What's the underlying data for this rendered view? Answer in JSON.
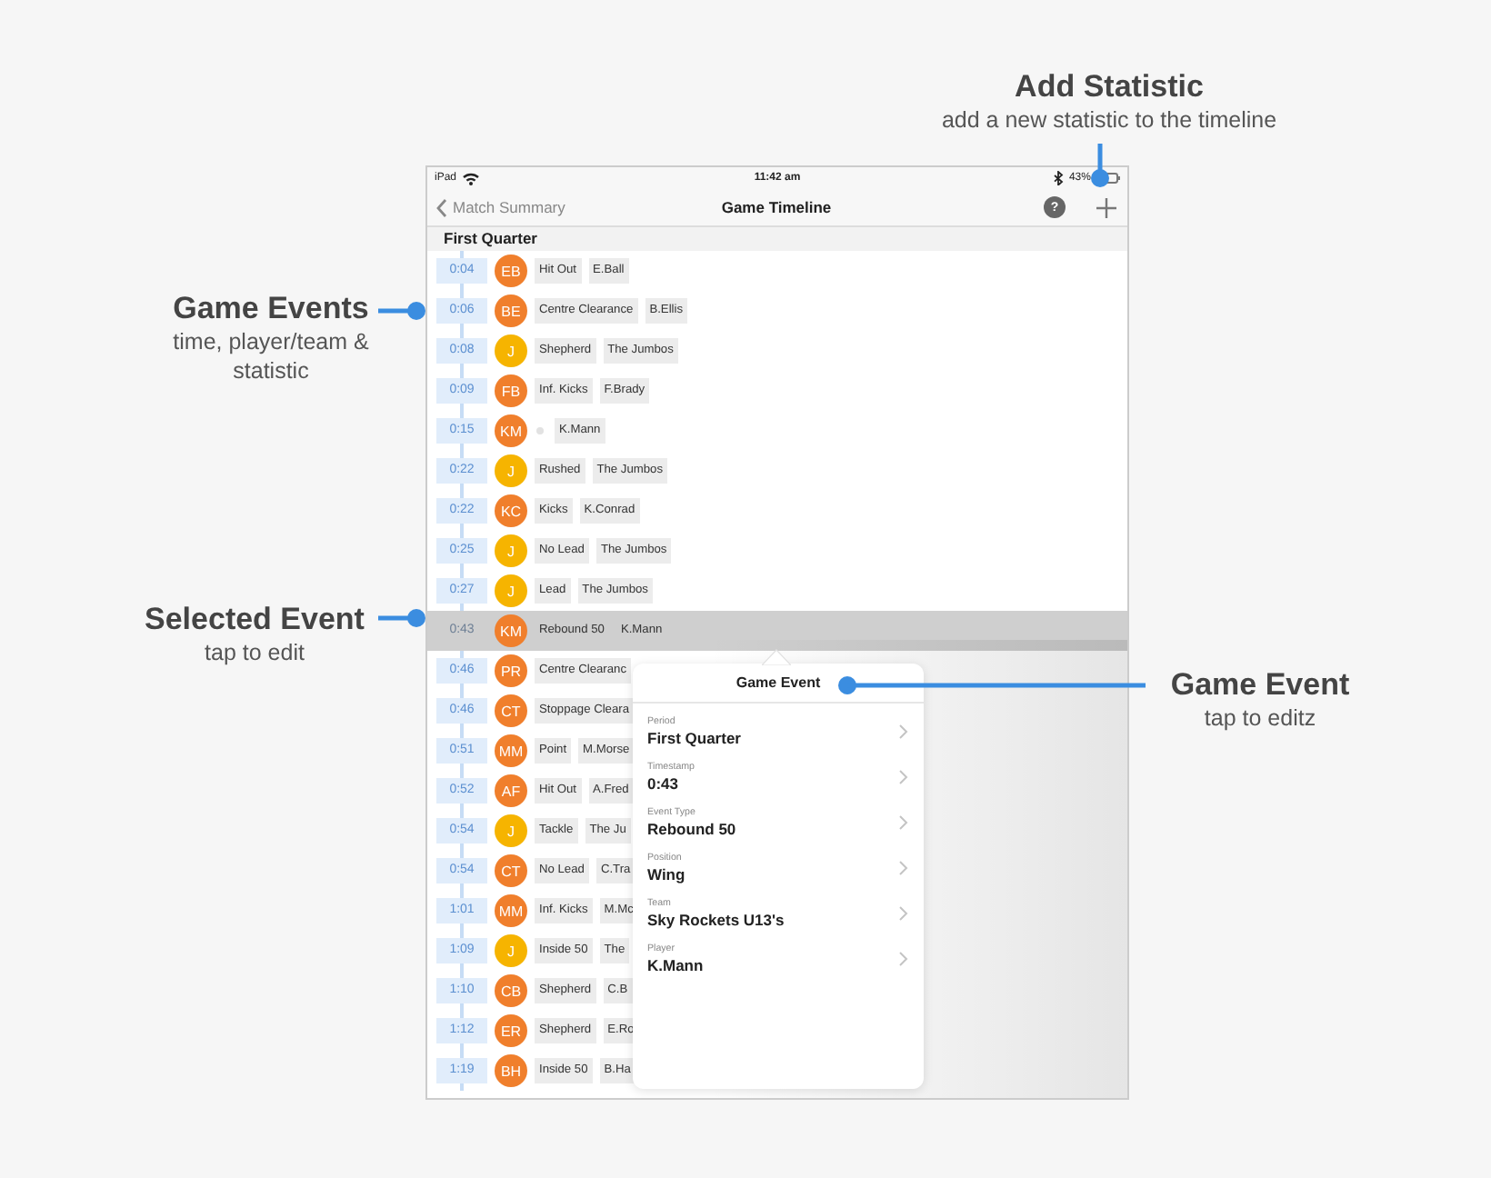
{
  "annotations": [
    {
      "title": "Add Statistic",
      "subtitle": "add a new statistic to the timeline"
    },
    {
      "title": "Game Events",
      "subtitle": "time, player/team & statistic"
    },
    {
      "title": "Selected Event",
      "subtitle": "tap to edit"
    },
    {
      "title": "Game Event",
      "subtitle": "tap to editz"
    }
  ],
  "status_bar": {
    "carrier": "iPad",
    "time": "11:42 am",
    "battery": "43%"
  },
  "nav": {
    "back": "Match Summary",
    "title": "Game Timeline",
    "help": "?"
  },
  "section": "First Quarter",
  "events": [
    {
      "time": "0:04",
      "initials": "EB",
      "color": "#f07f2c",
      "event": "Hit Out",
      "player": "E.Ball",
      "selected": false
    },
    {
      "time": "0:06",
      "initials": "BE",
      "color": "#f07f2c",
      "event": "Centre Clearance",
      "player": "B.Ellis",
      "selected": false
    },
    {
      "time": "0:08",
      "initials": "J",
      "color": "#f6b400",
      "event": "Shepherd",
      "player": "The Jumbos",
      "selected": false
    },
    {
      "time": "0:09",
      "initials": "FB",
      "color": "#f07f2c",
      "event": "Inf. Kicks",
      "player": "F.Brady",
      "selected": false
    },
    {
      "time": "0:15",
      "initials": "KM",
      "color": "#f07f2c",
      "player": "K.Mann",
      "selected": false
    },
    {
      "time": "0:22",
      "initials": "J",
      "color": "#f6b400",
      "event": "Rushed",
      "player": "The Jumbos",
      "selected": false
    },
    {
      "time": "0:22",
      "initials": "KC",
      "color": "#f07f2c",
      "event": "Kicks",
      "player": "K.Conrad",
      "selected": false
    },
    {
      "time": "0:25",
      "initials": "J",
      "color": "#f6b400",
      "event": "No Lead",
      "player": "The Jumbos",
      "selected": false
    },
    {
      "time": "0:27",
      "initials": "J",
      "color": "#f6b400",
      "event": "Lead",
      "player": "The Jumbos",
      "selected": false
    },
    {
      "time": "0:43",
      "initials": "KM",
      "color": "#f07f2c",
      "event": "Rebound 50",
      "player": "K.Mann",
      "selected": true
    },
    {
      "time": "0:46",
      "initials": "PR",
      "color": "#f07f2c",
      "event": "Centre Clearanc",
      "selected": false
    },
    {
      "time": "0:46",
      "initials": "CT",
      "color": "#f07f2c",
      "event": "Stoppage Cleara",
      "selected": false
    },
    {
      "time": "0:51",
      "initials": "MM",
      "color": "#f07f2c",
      "event": "Point",
      "player": "M.Morse",
      "selected": false
    },
    {
      "time": "0:52",
      "initials": "AF",
      "color": "#f07f2c",
      "event": "Hit Out",
      "player": "A.Fred",
      "selected": false
    },
    {
      "time": "0:54",
      "initials": "J",
      "color": "#f6b400",
      "event": "Tackle",
      "player": "The Ju",
      "selected": false
    },
    {
      "time": "0:54",
      "initials": "CT",
      "color": "#f07f2c",
      "event": "No Lead",
      "player": "C.Tra",
      "selected": false
    },
    {
      "time": "1:01",
      "initials": "MM",
      "color": "#f07f2c",
      "event": "Inf. Kicks",
      "player": "M.Mc",
      "selected": false
    },
    {
      "time": "1:09",
      "initials": "J",
      "color": "#f6b400",
      "event": "Inside 50",
      "player": "The",
      "selected": false
    },
    {
      "time": "1:10",
      "initials": "CB",
      "color": "#f07f2c",
      "event": "Shepherd",
      "player": "C.B",
      "selected": false
    },
    {
      "time": "1:12",
      "initials": "ER",
      "color": "#f07f2c",
      "event": "Shepherd",
      "player": "E.Ro",
      "selected": false
    },
    {
      "time": "1:19",
      "initials": "BH",
      "color": "#f07f2c",
      "event": "Inside 50",
      "player": "B.Ha",
      "selected": false
    }
  ],
  "popover": {
    "title": "Game Event",
    "fields": [
      {
        "label": "Period",
        "value": "First Quarter"
      },
      {
        "label": "Timestamp",
        "value": "0:43"
      },
      {
        "label": "Event Type",
        "value": "Rebound 50"
      },
      {
        "label": "Position",
        "value": "Wing"
      },
      {
        "label": "Team",
        "value": "Sky Rockets U13's"
      },
      {
        "label": "Player",
        "value": "K.Mann"
      }
    ]
  }
}
